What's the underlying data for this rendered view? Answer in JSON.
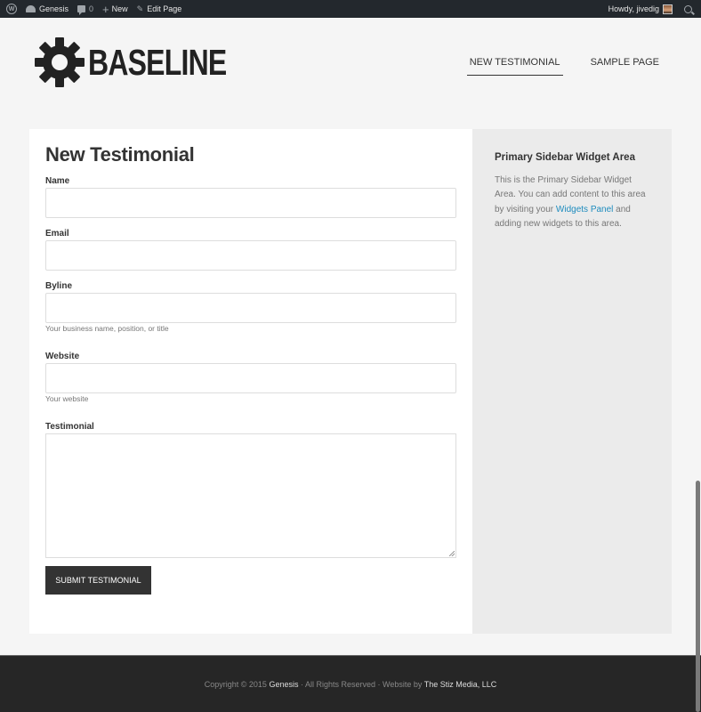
{
  "admin_bar": {
    "wp_logo_icon": "wordpress-icon",
    "site_name": "Genesis",
    "comments_count": "0",
    "new_label": "New",
    "edit_label": "Edit Page",
    "greeting": "Howdy, jivedig"
  },
  "header": {
    "logo_text": "BASELINE",
    "nav": [
      {
        "label": "NEW TESTIMONIAL",
        "active": true
      },
      {
        "label": "SAMPLE PAGE",
        "active": false
      }
    ]
  },
  "form": {
    "title": "New Testimonial",
    "fields": {
      "name": {
        "label": "Name",
        "value": "",
        "help": ""
      },
      "email": {
        "label": "Email",
        "value": "",
        "help": ""
      },
      "byline": {
        "label": "Byline",
        "value": "",
        "help": "Your business name, position, or title"
      },
      "website": {
        "label": "Website",
        "value": "",
        "help": "Your website"
      },
      "testimonial": {
        "label": "Testimonial",
        "value": "",
        "help": ""
      }
    },
    "submit_label": "SUBMIT TESTIMONIAL"
  },
  "sidebar": {
    "widget_title": "Primary Sidebar Widget Area",
    "text_before": "This is the Primary Sidebar Widget Area. You can add content to this area by visiting your ",
    "link_text": "Widgets Panel",
    "text_after": " and adding new widgets to this area."
  },
  "footer": {
    "copyright_prefix": "Copyright © 2015 ",
    "genesis_link": "Genesis",
    "middle": " · All Rights Reserved · Website by ",
    "author_link": "The Stiz Media, LLC"
  },
  "colors": {
    "admin_bar_bg": "#23282d",
    "link": "#1e8cbe",
    "button_bg": "#333333",
    "footer_bg": "#262626"
  }
}
